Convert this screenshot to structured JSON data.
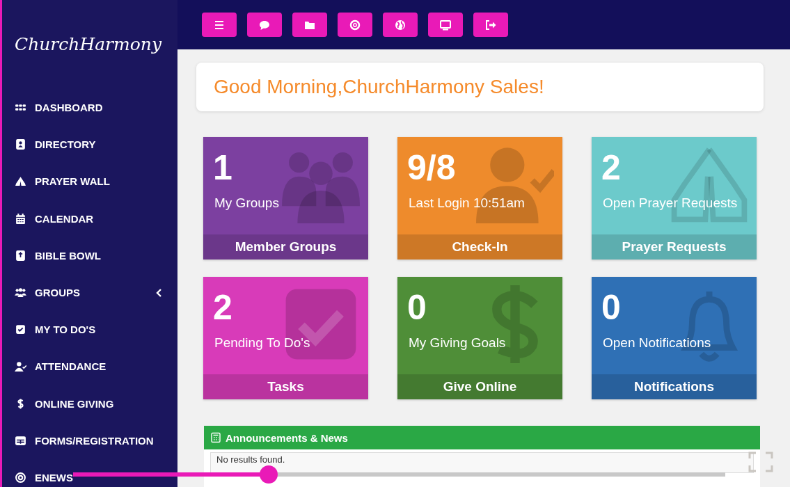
{
  "sidebar": {
    "logo": "ChurchHarmony",
    "items": [
      {
        "label": "DASHBOARD",
        "submenu": false
      },
      {
        "label": "DIRECTORY",
        "submenu": false
      },
      {
        "label": "PRAYER WALL",
        "submenu": false
      },
      {
        "label": "CALENDAR",
        "submenu": false
      },
      {
        "label": "BIBLE BOWL",
        "submenu": false
      },
      {
        "label": "GROUPS",
        "submenu": true
      },
      {
        "label": "MY TO DO'S",
        "submenu": false
      },
      {
        "label": "ATTENDANCE",
        "submenu": false
      },
      {
        "label": "ONLINE GIVING",
        "submenu": false
      },
      {
        "label": "FORMS/REGISTRATION",
        "submenu": false
      },
      {
        "label": "ENEWS",
        "submenu": false
      }
    ]
  },
  "greeting": "Good Morning,ChurchHarmony Sales!",
  "tiles": [
    {
      "kind": "groups",
      "value": "1",
      "label": "My Groups",
      "footer": "Member Groups",
      "color": "#7c40a0"
    },
    {
      "kind": "checkin",
      "value": "9/8",
      "label": "Last Login 10:51am",
      "footer": "Check-In",
      "color": "#ee8b2c"
    },
    {
      "kind": "prayer",
      "value": "2",
      "label": "Open Prayer Requests",
      "footer": "Prayer Requests",
      "color": "#6ccacb"
    },
    {
      "kind": "todo",
      "value": "2",
      "label": "Pending To Do's",
      "footer": "Tasks",
      "color": "#d83bb9"
    },
    {
      "kind": "dollar",
      "value": "0",
      "label": "My Giving Goals",
      "footer": "Give Online",
      "color": "#4f8e38"
    },
    {
      "kind": "bell",
      "value": "0",
      "label": "Open Notifications",
      "footer": "Notifications",
      "color": "#2f70b5"
    }
  ],
  "announcements": {
    "title": "Announcements & News",
    "empty_text": "No results found."
  },
  "player": {
    "level": 0.3
  }
}
